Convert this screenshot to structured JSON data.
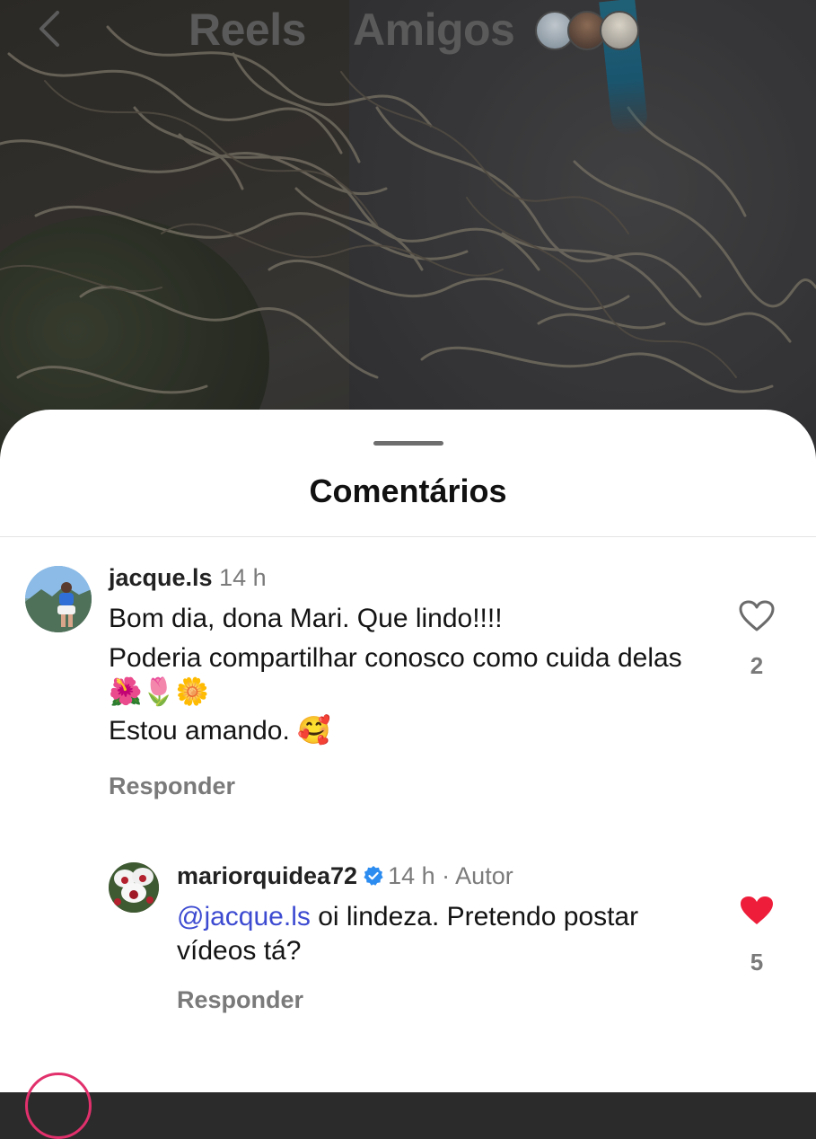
{
  "top_nav": {
    "tabs": [
      "Reels",
      "Amigos"
    ]
  },
  "sheet": {
    "title": "Comentários"
  },
  "comments": [
    {
      "username": "jacque.ls",
      "time": "14 h",
      "lines": [
        "Bom dia, dona Mari. Que lindo!!!!",
        "Poderia compartilhar conosco como cuida delas 🌺🌷🌼",
        "Estou amando. 🥰"
      ],
      "reply_label": "Responder",
      "likes": "2",
      "liked": false
    },
    {
      "username": "mariorquidea72",
      "verified": true,
      "time": "14 h",
      "author_label": "Autor",
      "mention": "@jacque.ls",
      "text": "oi lindeza. Pretendo postar vídeos tá?",
      "reply_label": "Responder",
      "likes": "5",
      "liked": true
    }
  ],
  "colors": {
    "mention": "#3d4bd1",
    "like_active": "#ee1d3a",
    "verified": "#2d8cf0"
  }
}
